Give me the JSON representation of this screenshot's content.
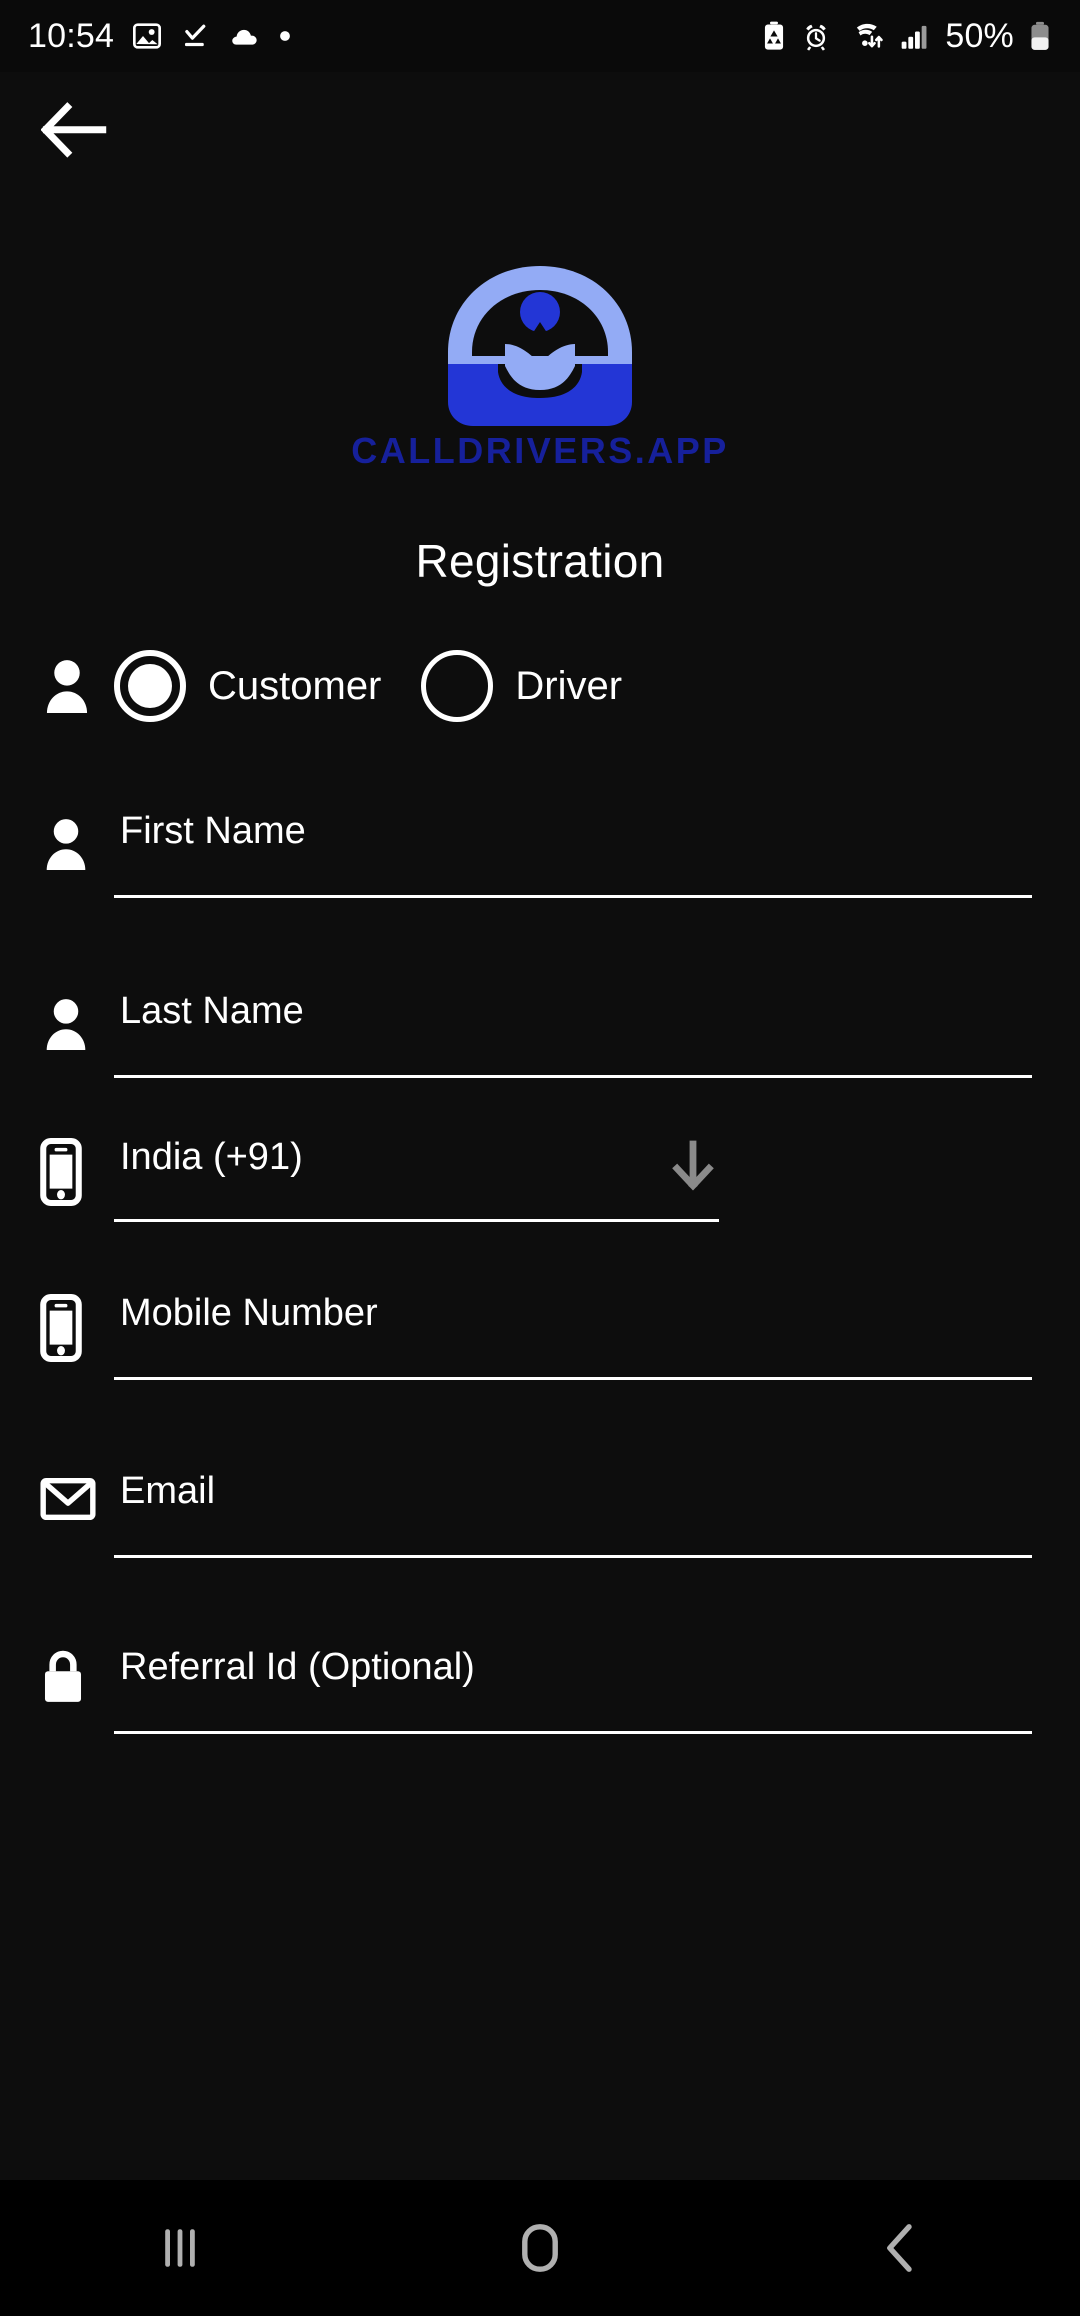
{
  "status_bar": {
    "time": "10:54",
    "left_icons": [
      "image-icon",
      "download-complete-icon",
      "cloud-icon",
      "dot-icon"
    ],
    "right_icons": [
      "battery-saver-icon",
      "alarm-icon",
      "wifi-icon",
      "signal-icon"
    ],
    "battery_percent": "50%"
  },
  "app_bar": {
    "back_label": "back-arrow-icon"
  },
  "brand": {
    "wordmark": "CALLDRIVERS.APP",
    "logo_light_blue": "#93abf5",
    "logo_deep_blue": "#2336d6",
    "wordmark_color": "#16209b"
  },
  "page": {
    "title": "Registration"
  },
  "role_selector": {
    "icon": "person-icon",
    "options": [
      {
        "label": "Customer",
        "selected": true
      },
      {
        "label": "Driver",
        "selected": false
      }
    ]
  },
  "fields": [
    {
      "name": "first-name",
      "icon": "person-icon",
      "placeholder": "First Name",
      "value": "",
      "type": "text"
    },
    {
      "name": "last-name",
      "icon": "person-icon",
      "placeholder": "Last Name",
      "value": "",
      "type": "text"
    },
    {
      "name": "country-code",
      "icon": "phone-icon",
      "placeholder": "India (+91)",
      "value": "India (+91)",
      "type": "select",
      "arrow": "down-arrow-icon",
      "arrow_color": "#8a8a8a"
    },
    {
      "name": "mobile-number",
      "icon": "phone-icon",
      "placeholder": "Mobile Number",
      "value": "",
      "type": "tel"
    },
    {
      "name": "email",
      "icon": "envelope-icon",
      "placeholder": "Email",
      "value": "",
      "type": "email"
    },
    {
      "name": "referral-id",
      "icon": "lock-icon",
      "placeholder": "Referral Id (Optional)",
      "value": "",
      "type": "text"
    }
  ],
  "nav_bar": {
    "items": [
      "recents-icon",
      "home-icon",
      "back-icon"
    ],
    "color": "#b0b0b0"
  }
}
